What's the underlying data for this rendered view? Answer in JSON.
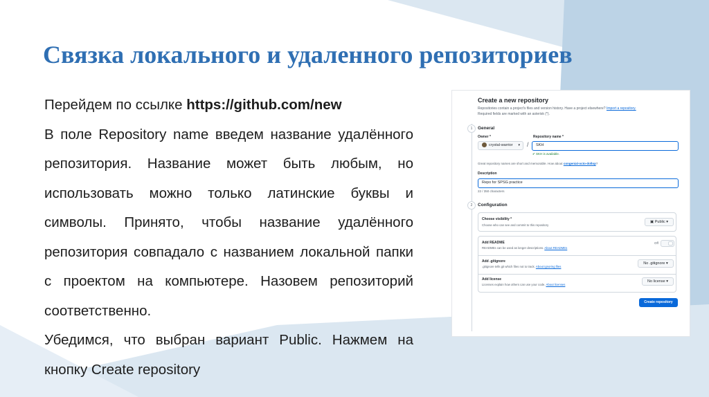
{
  "slide": {
    "title": "Связка локального и удаленного репозиториев",
    "paragraphs": [
      {
        "lead": "Перейдем по ссылке ",
        "url": "https://github.com/new"
      },
      {
        "text": "В поле Repository name введем название удалённого репозитория. Название может быть любым, но использовать можно только латинские буквы и символы. Принято, чтобы название удалённого репозитория совпадало с названием локальной папки с проектом на компьютере. Назовем репозиторий соответственно."
      },
      {
        "text": "Убедимся, что выбран вариант Public. Нажмем на кнопку Create repository"
      }
    ],
    "colors": {
      "title": "#2f6fb3",
      "band_dark": "#bcd3e6",
      "band_light": "#dbe7f1"
    }
  },
  "github": {
    "heading": "Create a new repository",
    "subtitle_line1_text": "Repositories contain a project's files and version history. Have a project elsewhere?",
    "subtitle_link": "Import a repository.",
    "subtitle_line2": "Required fields are marked with an asterisk (*).",
    "step1": "1",
    "step2": "2",
    "general": "General",
    "owner_label": "Owner *",
    "owner_value": "crystal-warrior",
    "owner_avatar_icon": "avatar-icon",
    "slash": "/",
    "repo_label": "Repository name *",
    "repo_value": "SKH",
    "availability": "SKH is available.",
    "hint_text": "Great repository names are short and memorable. How about",
    "hint_suggestion": "congenial-octo-dollop",
    "hint_end": "?",
    "description_label": "Description",
    "description_value": "Repo for SPSG practice",
    "char_count": "22 / 350 characters",
    "configuration": "Configuration",
    "visibility": {
      "title": "Choose visibility *",
      "desc": "Choose who can see and commit to this repository",
      "value": "Public"
    },
    "readme": {
      "title": "Add README",
      "desc_text": "READMEs can be used as longer descriptions.",
      "desc_link": "About READMEs",
      "state": "Off"
    },
    "gitignore": {
      "title": "Add .gitignore",
      "desc_text": ".gitignore tells git which files not to track.",
      "desc_link": "About ignoring files",
      "value": "No .gitignore"
    },
    "license": {
      "title": "Add license",
      "desc_text": "Licenses explain how others can use your code.",
      "desc_link": "About licenses",
      "value": "No license"
    },
    "create_button": "Create repository",
    "colors": {
      "accent": "#0969da",
      "success": "#1a7f37",
      "border": "#d0d7de"
    }
  }
}
